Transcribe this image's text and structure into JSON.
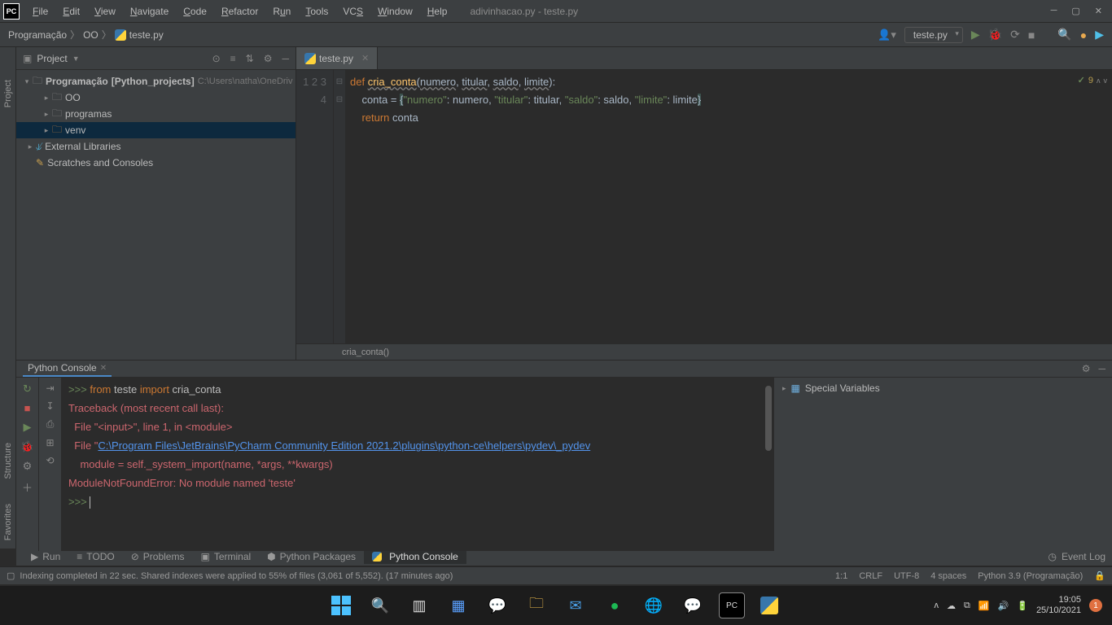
{
  "window": {
    "title": "adivinhacao.py - teste.py",
    "menus": [
      "File",
      "Edit",
      "View",
      "Navigate",
      "Code",
      "Refactor",
      "Run",
      "Tools",
      "VCS",
      "Window",
      "Help"
    ]
  },
  "breadcrumb": {
    "root": "Programação",
    "mid": "OO",
    "file": "teste.py"
  },
  "runConfig": "teste.py",
  "projectPanel": {
    "title": "Project",
    "rootName": "Programação",
    "rootQualifier": "[Python_projects]",
    "rootPath": "C:\\Users\\natha\\OneDriv",
    "items": [
      "OO",
      "programas",
      "venv"
    ],
    "externalLibs": "External Libraries",
    "scratches": "Scratches and Consoles"
  },
  "leftRail": {
    "project": "Project",
    "structure": "Structure",
    "favorites": "Favorites"
  },
  "editor": {
    "tabFile": "teste.py",
    "inspections": "9",
    "breadcrumbFn": "cria_conta()",
    "lines": {
      "l1": {
        "def": "def ",
        "fn": "cria_conta",
        "po": "(",
        "p1": "numero",
        "c": ", ",
        "p2": "titular",
        "p3": "saldo",
        "p4": "limite",
        "pc": "):"
      },
      "l2": {
        "indent": "    ",
        "var": "conta ",
        "eq": "= ",
        "ob": "{",
        "k1": "\"numero\"",
        "sep": ": ",
        "v1": "numero",
        "cm": ", ",
        "k2": "\"titular\"",
        "v2": "titular",
        "k3": "\"saldo\"",
        "v3": "saldo",
        "k4": "\"limite\"",
        "v4": "limite",
        "cb": "}"
      },
      "l3": {
        "indent": "    ",
        "ret": "return ",
        "var": "conta"
      }
    }
  },
  "console": {
    "tabTitle": "Python Console",
    "specialVars": "Special Variables",
    "lines": {
      "prompt": ">>> ",
      "l1_from": "from ",
      "l1_mod": "teste ",
      "l1_imp": "import ",
      "l1_name": "cria_conta",
      "l2": "Traceback (most recent call last):",
      "l3": "  File \"<input>\", line 1, in <module>",
      "l4a": "  File \"",
      "l4b": "C:\\Program Files\\JetBrains\\PyCharm Community Edition 2021.2\\plugins\\python-ce\\helpers\\pydev\\_pydev",
      "l5": "    module = self._system_import(name, *args, **kwargs)",
      "l6": "ModuleNotFoundError: No module named 'teste'"
    }
  },
  "toolWindows": {
    "run": "Run",
    "todo": "TODO",
    "problems": "Problems",
    "terminal": "Terminal",
    "packages": "Python Packages",
    "console": "Python Console",
    "eventLog": "Event Log"
  },
  "status": {
    "message": "Indexing completed in 22 sec. Shared indexes were applied to 55% of files (3,061 of 5,552). (17 minutes ago)",
    "pos": "1:1",
    "lineSep": "CRLF",
    "encoding": "UTF-8",
    "indent": "4 spaces",
    "interpreter": "Python 3.9 (Programação)"
  },
  "taskbar": {
    "time": "19:05",
    "date": "25/10/2021",
    "notif": "1"
  }
}
